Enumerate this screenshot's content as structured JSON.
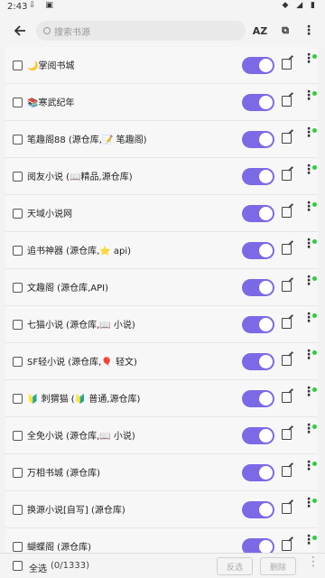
{
  "status": {
    "time": "2:43",
    "left_icons": "⇩ ▣",
    "right_icons": "◆ ◢ ▮"
  },
  "toolbar": {
    "search_placeholder": "搜索书源",
    "sort_label": "AZ",
    "group_label": "⧉"
  },
  "sources": [
    {
      "name": "🌙掌阅书城"
    },
    {
      "name": "📚寒武纪年"
    },
    {
      "name": "笔趣阁88 (源仓库,📝 笔趣阁)"
    },
    {
      "name": "阅友小说 (📖精品,源仓库)"
    },
    {
      "name": "天域小说网"
    },
    {
      "name": "追书神器 (源仓库,⭐ api)"
    },
    {
      "name": "文趣阁 (源仓库,API)"
    },
    {
      "name": "七猫小说 (源仓库,📖 小说)"
    },
    {
      "name": "SF轻小说 (源仓库,🎈 轻文)"
    },
    {
      "name": "🔰 刺猬猫 (🔰 普通,源仓库)"
    },
    {
      "name": "全免小说 (源仓库,📖 小说)"
    },
    {
      "name": "万相书城 (源仓库)"
    },
    {
      "name": "换源小说[自写] (源仓库)"
    },
    {
      "name": "蝴蝶阁 (源仓库)"
    }
  ],
  "bottom": {
    "select_all": "全选",
    "count": "(0/1333)",
    "invert": "反选",
    "delete": "删除"
  },
  "colors": {
    "accent": "#7b6ae6",
    "enabled_dot": "#2ecc40"
  }
}
